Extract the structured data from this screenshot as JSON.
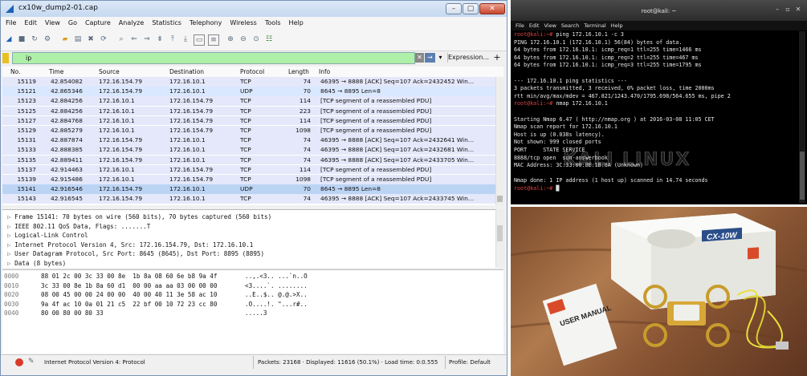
{
  "wireshark": {
    "title": "cx10w_dump2-01.cap",
    "menu": [
      "File",
      "Edit",
      "View",
      "Go",
      "Capture",
      "Analyze",
      "Statistics",
      "Telephony",
      "Wireless",
      "Tools",
      "Help"
    ],
    "filter": {
      "value": "ip",
      "expression_label": "Expression..."
    },
    "columns": [
      "No.",
      "Time",
      "Source",
      "Destination",
      "Protocol",
      "Length",
      "Info"
    ],
    "packets": [
      {
        "no": "15119",
        "time": "42.854082",
        "src": "172.16.154.79",
        "dst": "172.16.10.1",
        "proto": "TCP",
        "len": "74",
        "info": "46395 → 8888 [ACK] Seq=107 Ack=2432452 Win…",
        "bg": "#e4e8fa"
      },
      {
        "no": "15121",
        "time": "42.865346",
        "src": "172.16.154.79",
        "dst": "172.16.10.1",
        "proto": "UDP",
        "len": "70",
        "info": "8645 → 8895  Len=8",
        "bg": "#dae8ff"
      },
      {
        "no": "15123",
        "time": "42.884256",
        "src": "172.16.10.1",
        "dst": "172.16.154.79",
        "proto": "TCP",
        "len": "114",
        "info": "[TCP segment of a reassembled PDU]",
        "bg": "#e4e8fa"
      },
      {
        "no": "15125",
        "time": "42.884256",
        "src": "172.16.10.1",
        "dst": "172.16.154.79",
        "proto": "TCP",
        "len": "223",
        "info": "[TCP segment of a reassembled PDU]",
        "bg": "#e4e8fa"
      },
      {
        "no": "15127",
        "time": "42.884768",
        "src": "172.16.10.1",
        "dst": "172.16.154.79",
        "proto": "TCP",
        "len": "114",
        "info": "[TCP segment of a reassembled PDU]",
        "bg": "#e4e8fa"
      },
      {
        "no": "15129",
        "time": "42.885279",
        "src": "172.16.10.1",
        "dst": "172.16.154.79",
        "proto": "TCP",
        "len": "1098",
        "info": "[TCP segment of a reassembled PDU]",
        "bg": "#e4e8fa"
      },
      {
        "no": "15131",
        "time": "42.887874",
        "src": "172.16.154.79",
        "dst": "172.16.10.1",
        "proto": "TCP",
        "len": "74",
        "info": "46395 → 8888 [ACK] Seq=107 Ack=2432641 Win…",
        "bg": "#e4e8fa"
      },
      {
        "no": "15133",
        "time": "42.888385",
        "src": "172.16.154.79",
        "dst": "172.16.10.1",
        "proto": "TCP",
        "len": "74",
        "info": "46395 → 8888 [ACK] Seq=107 Ack=2432681 Win…",
        "bg": "#e4e8fa"
      },
      {
        "no": "15135",
        "time": "42.889411",
        "src": "172.16.154.79",
        "dst": "172.16.10.1",
        "proto": "TCP",
        "len": "74",
        "info": "46395 → 8888 [ACK] Seq=107 Ack=2433705 Win…",
        "bg": "#e4e8fa"
      },
      {
        "no": "15137",
        "time": "42.914463",
        "src": "172.16.10.1",
        "dst": "172.16.154.79",
        "proto": "TCP",
        "len": "114",
        "info": "[TCP segment of a reassembled PDU]",
        "bg": "#e4e8fa"
      },
      {
        "no": "15139",
        "time": "42.915486",
        "src": "172.16.10.1",
        "dst": "172.16.154.79",
        "proto": "TCP",
        "len": "1098",
        "info": "[TCP segment of a reassembled PDU]",
        "bg": "#e4e8fa"
      },
      {
        "no": "15141",
        "time": "42.916546",
        "src": "172.16.154.79",
        "dst": "172.16.10.1",
        "proto": "UDP",
        "len": "70",
        "info": "8645 → 8895  Len=8",
        "bg": "#bcd4f4"
      },
      {
        "no": "15143",
        "time": "42.916545",
        "src": "172.16.154.79",
        "dst": "172.16.10.1",
        "proto": "TCP",
        "len": "74",
        "info": "46395 → 8888 [ACK] Seq=107 Ack=2433745 Win…",
        "bg": "#e4e8fa"
      }
    ],
    "details": [
      "Frame 15141: 70 bytes on wire (560 bits), 70 bytes captured (560 bits)",
      "IEEE 802.11 QoS Data, Flags: .......T",
      "Logical-Link Control",
      "Internet Protocol Version 4, Src: 172.16.154.79, Dst: 172.16.10.1",
      "User Datagram Protocol, Src Port: 8645 (8645), Dst Port: 8895 (8895)",
      "Data (8 bytes)"
    ],
    "bytes": [
      {
        "off": "0000",
        "hex": "88 01 2c 00 3c 33 00 8e  1b 8a 08 60 6e b8 9a 4f",
        "ascii": "..,.<3.. ...`n..O"
      },
      {
        "off": "0010",
        "hex": "3c 33 00 8e 1b 8a 60 d1  00 00 aa aa 03 00 00 00",
        "ascii": "<3....`. ........"
      },
      {
        "off": "0020",
        "hex": "08 00 45 00 00 24 00 00  40 00 40 11 3e 58 ac 10",
        "ascii": "..E..$.. @.@.>X.."
      },
      {
        "off": "0030",
        "hex": "9a 4f ac 10 0a 01 21 c5  22 bf 00 10 72 23 cc 80",
        "ascii": ".O....!. \"...r#.."
      },
      {
        "off": "0040",
        "hex": "80 00 80 00 80 33",
        "ascii": ".....3"
      }
    ],
    "status": {
      "field": "Internet Protocol Version 4: Protocol",
      "packets": "Packets: 23168 · Displayed: 11616 (50.1%) · Load time: 0:0.555",
      "profile": "Profile: Default"
    }
  },
  "terminal": {
    "title": "root@kali: ~",
    "menu": [
      "File",
      "Edit",
      "View",
      "Search",
      "Terminal",
      "Help"
    ],
    "lines": [
      {
        "p": "root@kali:~#",
        "t": " ping 172.16.10.1 -c 3"
      },
      {
        "p": "",
        "t": "PING 172.16.10.1 (172.16.10.1) 56(84) bytes of data."
      },
      {
        "p": "",
        "t": "64 bytes from 172.16.10.1: icmp_req=1 ttl=255 time=1466 ms"
      },
      {
        "p": "",
        "t": "64 bytes from 172.16.10.1: icmp_req=2 ttl=255 time=467 ms"
      },
      {
        "p": "",
        "t": "64 bytes from 172.16.10.1: icmp_req=3 ttl=255 time=1795 ms"
      },
      {
        "p": "",
        "t": ""
      },
      {
        "p": "",
        "t": "--- 172.16.10.1 ping statistics ---"
      },
      {
        "p": "",
        "t": "3 packets transmitted, 3 received, 0% packet loss, time 2000ms"
      },
      {
        "p": "",
        "t": "rtt min/avg/max/mdev = 467.821/1243.470/1795.698/564.655 ms, pipe 2"
      },
      {
        "p": "root@kali:~#",
        "t": " nmap 172.16.10.1"
      },
      {
        "p": "",
        "t": ""
      },
      {
        "p": "",
        "t": "Starting Nmap 6.47 ( http://nmap.org ) at 2016-03-08 11:05 CET"
      },
      {
        "p": "",
        "t": "Nmap scan report for 172.16.10.1"
      },
      {
        "p": "",
        "t": "Host is up (0.038s latency)."
      },
      {
        "p": "",
        "t": "Not shown: 999 closed ports"
      },
      {
        "p": "",
        "t": "PORT     STATE SERVICE"
      },
      {
        "p": "",
        "t": "8888/tcp open  sun-answerbook"
      },
      {
        "p": "",
        "t": "MAC Address: 3C:33:00:8E:1B:8A (Unknown)"
      },
      {
        "p": "",
        "t": ""
      },
      {
        "p": "",
        "t": "Nmap done: 1 IP address (1 host up) scanned in 14.74 seconds"
      },
      {
        "p": "root@kali:~#",
        "t": " "
      }
    ],
    "watermark": "KALI LINUX"
  },
  "photo": {
    "box_model": "CX-10W",
    "manual_text": "USER MANUAL"
  }
}
